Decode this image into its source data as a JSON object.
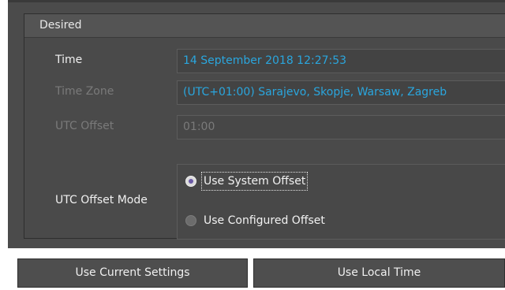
{
  "group": {
    "title": "Desired"
  },
  "time": {
    "label": "Time",
    "value": "14 September 2018 12:27:53"
  },
  "time_zone": {
    "label": "Time Zone",
    "value": "(UTC+01:00) Sarajevo, Skopje, Warsaw, Zagreb"
  },
  "utc_offset": {
    "label": "UTC Offset",
    "value": "01:00"
  },
  "utc_offset_mode": {
    "label": "UTC Offset Mode",
    "options": [
      {
        "label": "Use System Offset",
        "checked": true
      },
      {
        "label": "Use Configured Offset",
        "checked": false
      }
    ]
  },
  "buttons": {
    "use_current": "Use Current Settings",
    "use_local": "Use Local Time"
  },
  "colors": {
    "accent": "#2aa6de",
    "panel_bg": "#4b4b4b",
    "text": "#f0f0f0",
    "disabled_text": "#7a7a7a"
  }
}
